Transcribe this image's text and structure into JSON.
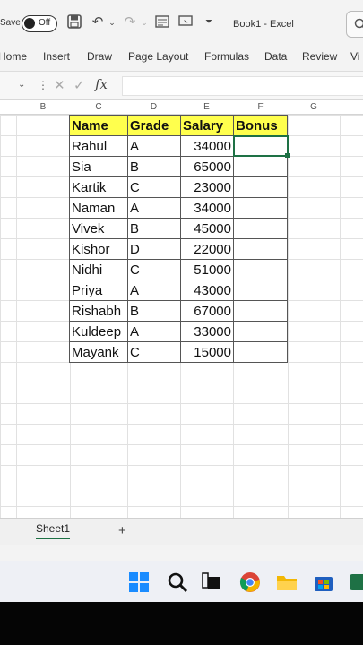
{
  "titlebar": {
    "autosave_label": "Save",
    "autosave_state": "Off",
    "document_title": "Book1  -  Excel"
  },
  "ribbon": {
    "tabs": [
      "Home",
      "Insert",
      "Draw",
      "Page Layout",
      "Formulas",
      "Data",
      "Review",
      "Vi"
    ]
  },
  "formula_bar": {
    "fx_label": "fx",
    "cancel_glyph": "✕",
    "enter_glyph": "✓"
  },
  "columns": [
    "B",
    "C",
    "D",
    "E",
    "F",
    "G"
  ],
  "table": {
    "headers": [
      "Name",
      "Grade",
      "Salary",
      "Bonus"
    ],
    "rows": [
      [
        "Rahul",
        "A",
        "34000",
        ""
      ],
      [
        "Sia",
        "B",
        "65000",
        ""
      ],
      [
        "Kartik",
        "C",
        "23000",
        ""
      ],
      [
        "Naman",
        "A",
        "34000",
        ""
      ],
      [
        "Vivek",
        "B",
        "45000",
        ""
      ],
      [
        "Kishor",
        "D",
        "22000",
        ""
      ],
      [
        "Nidhi",
        "C",
        "51000",
        ""
      ],
      [
        "Priya",
        "A",
        "43000",
        ""
      ],
      [
        "Rishabh",
        "B",
        "67000",
        ""
      ],
      [
        "Kuldeep",
        "A",
        "33000",
        ""
      ],
      [
        "Mayank",
        "C",
        "15000",
        ""
      ]
    ]
  },
  "sheets": {
    "active": "Sheet1",
    "add_label": "+"
  },
  "colors": {
    "header_fill": "#ffff4d",
    "accent": "#1e7145"
  },
  "taskbar": {
    "icons": [
      "windows-start-icon",
      "search-icon",
      "task-view-icon",
      "chrome-icon",
      "file-explorer-icon",
      "store-icon",
      "office-icon"
    ]
  }
}
